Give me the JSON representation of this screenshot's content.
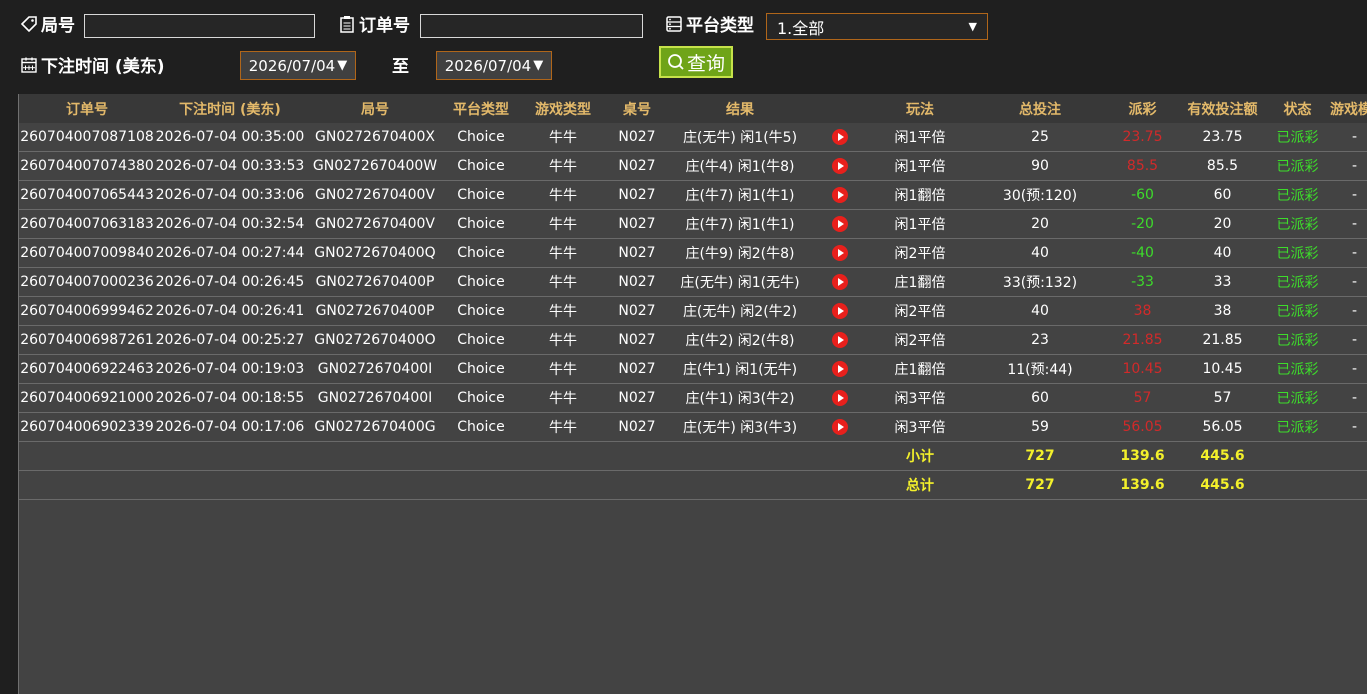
{
  "filters": {
    "game_no_label": "局号",
    "game_no_value": "",
    "order_no_label": "订单号",
    "order_no_value": "",
    "platform_label": "平台类型",
    "platform_value": "1.全部",
    "time_label": "下注时间 (美东)",
    "date_from": "2026/07/04",
    "to_label": "至",
    "date_to": "2026/07/04",
    "query_label": "查询"
  },
  "table": {
    "headers": [
      "订单号",
      "下注时间 (美东)",
      "局号",
      "平台类型",
      "游戏类型",
      "桌号",
      "结果",
      "",
      "玩法",
      "总投注",
      "派彩",
      "有效投注额",
      "状态",
      "游戏模式"
    ],
    "rows": [
      {
        "order": "260704007087108",
        "time": "2026-07-04 00:35:00",
        "game": "GN0272670400X",
        "platform": "Choice",
        "type": "牛牛",
        "table": "N027",
        "result": "庄(无牛) 闲1(牛5)",
        "play": "闲1平倍",
        "bet": "25",
        "payout": "23.75",
        "payout_color": "red",
        "valid": "23.75",
        "status": "已派彩",
        "mode": "-"
      },
      {
        "order": "260704007074380",
        "time": "2026-07-04 00:33:53",
        "game": "GN0272670400W",
        "platform": "Choice",
        "type": "牛牛",
        "table": "N027",
        "result": "庄(牛4) 闲1(牛8)",
        "play": "闲1平倍",
        "bet": "90",
        "payout": "85.5",
        "payout_color": "red",
        "valid": "85.5",
        "status": "已派彩",
        "mode": "-"
      },
      {
        "order": "260704007065443",
        "time": "2026-07-04 00:33:06",
        "game": "GN0272670400V",
        "platform": "Choice",
        "type": "牛牛",
        "table": "N027",
        "result": "庄(牛7) 闲1(牛1)",
        "play": "闲1翻倍",
        "bet": "30(预:120)",
        "payout": "-60",
        "payout_color": "green",
        "valid": "60",
        "status": "已派彩",
        "mode": "-"
      },
      {
        "order": "260704007063183",
        "time": "2026-07-04 00:32:54",
        "game": "GN0272670400V",
        "platform": "Choice",
        "type": "牛牛",
        "table": "N027",
        "result": "庄(牛7) 闲1(牛1)",
        "play": "闲1平倍",
        "bet": "20",
        "payout": "-20",
        "payout_color": "green",
        "valid": "20",
        "status": "已派彩",
        "mode": "-"
      },
      {
        "order": "260704007009840",
        "time": "2026-07-04 00:27:44",
        "game": "GN0272670400Q",
        "platform": "Choice",
        "type": "牛牛",
        "table": "N027",
        "result": "庄(牛9) 闲2(牛8)",
        "play": "闲2平倍",
        "bet": "40",
        "payout": "-40",
        "payout_color": "green",
        "valid": "40",
        "status": "已派彩",
        "mode": "-"
      },
      {
        "order": "260704007000236",
        "time": "2026-07-04 00:26:45",
        "game": "GN0272670400P",
        "platform": "Choice",
        "type": "牛牛",
        "table": "N027",
        "result": "庄(无牛) 闲1(无牛)",
        "play": "庄1翻倍",
        "bet": "33(预:132)",
        "payout": "-33",
        "payout_color": "green",
        "valid": "33",
        "status": "已派彩",
        "mode": "-"
      },
      {
        "order": "260704006999462",
        "time": "2026-07-04 00:26:41",
        "game": "GN0272670400P",
        "platform": "Choice",
        "type": "牛牛",
        "table": "N027",
        "result": "庄(无牛) 闲2(牛2)",
        "play": "闲2平倍",
        "bet": "40",
        "payout": "38",
        "payout_color": "red",
        "valid": "38",
        "status": "已派彩",
        "mode": "-"
      },
      {
        "order": "260704006987261",
        "time": "2026-07-04 00:25:27",
        "game": "GN0272670400O",
        "platform": "Choice",
        "type": "牛牛",
        "table": "N027",
        "result": "庄(牛2) 闲2(牛8)",
        "play": "闲2平倍",
        "bet": "23",
        "payout": "21.85",
        "payout_color": "red",
        "valid": "21.85",
        "status": "已派彩",
        "mode": "-"
      },
      {
        "order": "260704006922463",
        "time": "2026-07-04 00:19:03",
        "game": "GN0272670400I",
        "platform": "Choice",
        "type": "牛牛",
        "table": "N027",
        "result": "庄(牛1) 闲1(无牛)",
        "play": "庄1翻倍",
        "bet": "11(预:44)",
        "payout": "10.45",
        "payout_color": "red",
        "valid": "10.45",
        "status": "已派彩",
        "mode": "-"
      },
      {
        "order": "260704006921000",
        "time": "2026-07-04 00:18:55",
        "game": "GN0272670400I",
        "platform": "Choice",
        "type": "牛牛",
        "table": "N027",
        "result": "庄(牛1) 闲3(牛2)",
        "play": "闲3平倍",
        "bet": "60",
        "payout": "57",
        "payout_color": "red",
        "valid": "57",
        "status": "已派彩",
        "mode": "-"
      },
      {
        "order": "260704006902339",
        "time": "2026-07-04 00:17:06",
        "game": "GN0272670400G",
        "platform": "Choice",
        "type": "牛牛",
        "table": "N027",
        "result": "庄(无牛) 闲3(牛3)",
        "play": "闲3平倍",
        "bet": "59",
        "payout": "56.05",
        "payout_color": "red",
        "valid": "56.05",
        "status": "已派彩",
        "mode": "-"
      }
    ],
    "subtotal": {
      "label": "小计",
      "bet": "727",
      "payout": "139.6",
      "valid": "445.6"
    },
    "total": {
      "label": "总计",
      "bet": "727",
      "payout": "139.6",
      "valid": "445.6"
    }
  },
  "colors": {
    "header_text": "#e3b96a",
    "sum_text": "#f3f02b",
    "negative": "#3ddc2b",
    "positive": "#d12a2a",
    "status": "#3ddc2b",
    "accent": "#b0661a"
  },
  "icons": [
    "tag-icon",
    "clipboard-icon",
    "database-icon",
    "calendar-icon",
    "search-icon",
    "play-icon"
  ]
}
